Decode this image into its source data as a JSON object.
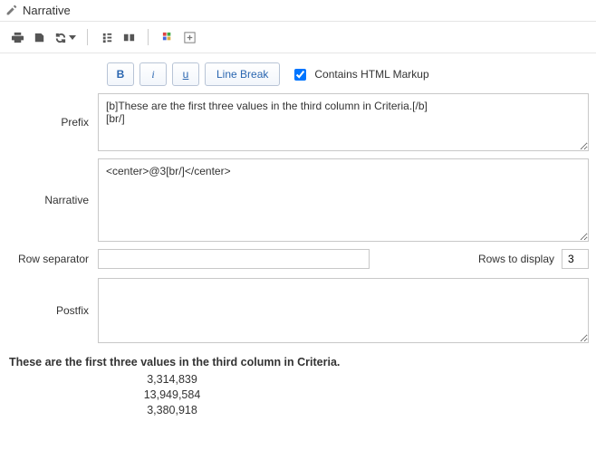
{
  "header": {
    "title": "Narrative"
  },
  "toolbar_icons": {
    "print": "print-icon",
    "export": "export-icon",
    "refresh": "refresh-icon",
    "align": "align-icon",
    "fit": "fit-icon",
    "grid": "grid-icon",
    "add": "add-icon"
  },
  "format": {
    "bold": "B",
    "italic": "i",
    "underline": "u",
    "line_break": "Line Break",
    "contains_html_label": "Contains HTML Markup",
    "contains_html_checked": true
  },
  "fields": {
    "prefix_label": "Prefix",
    "prefix_value": "[b]These are the first three values in the third column in Criteria.[/b]\n[br/]",
    "narrative_label": "Narrative",
    "narrative_value": "<center>@3[br/]</center>",
    "row_sep_label": "Row separator",
    "row_sep_value": "",
    "rows_label": "Rows to display",
    "rows_value": "3",
    "postfix_label": "Postfix",
    "postfix_value": ""
  },
  "preview": {
    "title": "These are the first three values in the third column in Criteria.",
    "values": [
      "3,314,839",
      "13,949,584",
      "3,380,918"
    ]
  }
}
